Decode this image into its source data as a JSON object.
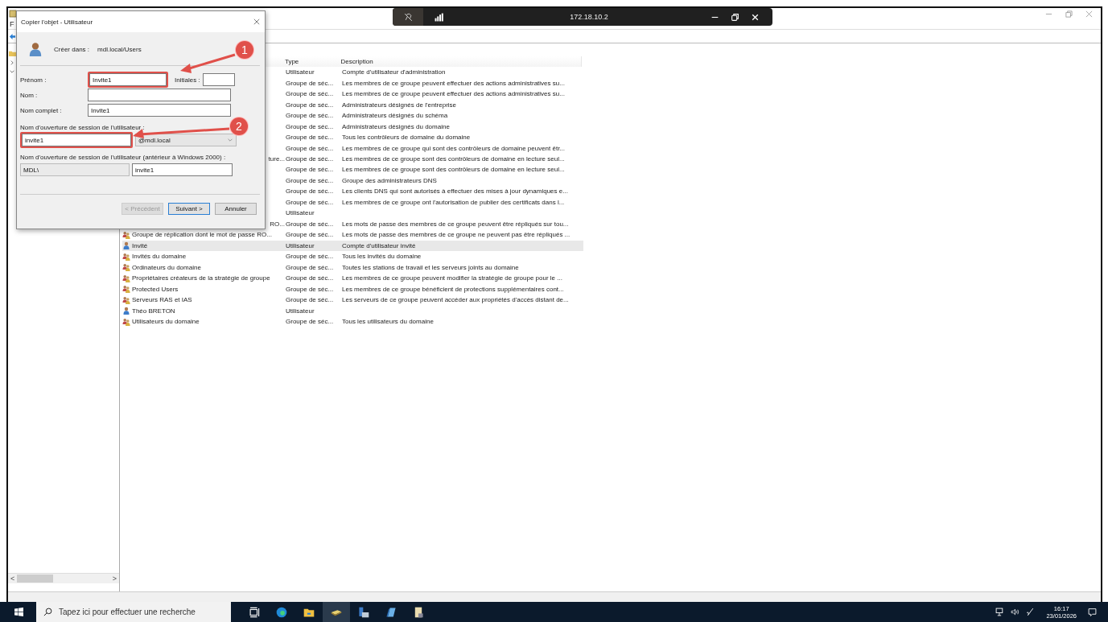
{
  "remote_bar": {
    "address": "172.18.10.2"
  },
  "main_window": {
    "menu": [
      "F"
    ]
  },
  "tree": {
    "items": [
      {
        "expanded": false
      },
      {
        "expanded": true
      }
    ]
  },
  "list": {
    "columns": [
      {
        "label": "Type"
      },
      {
        "label": "Description"
      }
    ],
    "rows": [
      {
        "type": "Utilisateur",
        "description": "Compte d'utilisateur d'administration",
        "selected": false
      },
      {
        "type": "Groupe de séc...",
        "description": "Les membres de ce groupe peuvent effectuer des actions administratives su...",
        "selected": false
      },
      {
        "type": "Groupe de séc...",
        "description": "Les membres de ce groupe peuvent effectuer des actions administratives su...",
        "selected": false
      },
      {
        "type": "Groupe de séc...",
        "description": "Administrateurs désignés de l'entreprise",
        "selected": false
      },
      {
        "type": "Groupe de séc...",
        "description": "Administrateurs désignés du schéma",
        "selected": false
      },
      {
        "type": "Groupe de séc...",
        "description": "Administrateurs désignés du domaine",
        "selected": false
      },
      {
        "type": "Groupe de séc...",
        "description": "Tous les contrôleurs de domaine du domaine",
        "selected": false
      },
      {
        "type": "Groupe de séc...",
        "description": "Les membres de ce groupe qui sont des contrôleurs de domaine peuvent êtr...",
        "selected": false
      },
      {
        "name": "ture...",
        "cut": true,
        "type": "Groupe de séc...",
        "description": "Les membres de ce groupe sont des contrôleurs de domaine en lecture seul...",
        "selected": false
      },
      {
        "type": "Groupe de séc...",
        "description": "Les membres de ce groupe sont des contrôleurs de domaine en lecture seul...",
        "selected": false
      },
      {
        "type": "Groupe de séc...",
        "description": "Groupe des administrateurs DNS",
        "selected": false
      },
      {
        "type": "Groupe de séc...",
        "description": "Les clients DNS qui sont autorisés à effectuer des mises à jour dynamiques e...",
        "selected": false
      },
      {
        "type": "Groupe de séc...",
        "description": "Les membres de ce groupe ont l'autorisation de publier des certificats dans l...",
        "selected": false
      },
      {
        "type": "Utilisateur",
        "selected": false
      },
      {
        "name": "RO...",
        "cut": true,
        "type": "Groupe de séc...",
        "description": "Les mots de passe des membres de ce groupe peuvent être répliqués sur tou...",
        "selected": false
      },
      {
        "name": "Groupe de réplication dont le mot de passe RO...",
        "kind": "group",
        "type": "Groupe de séc...",
        "description": "Les mots de passe des membres de ce groupe ne peuvent pas être répliqués ...",
        "selected": false
      },
      {
        "name": "Invité",
        "kind": "user",
        "type": "Utilisateur",
        "description": "Compte d'utilisateur invité",
        "selected": true
      },
      {
        "name": "Invités du domaine",
        "kind": "group",
        "type": "Groupe de séc...",
        "description": "Tous les invités du domaine",
        "selected": false
      },
      {
        "name": "Ordinateurs du domaine",
        "kind": "group",
        "type": "Groupe de séc...",
        "description": "Toutes les stations de travail et les serveurs joints au domaine",
        "selected": false
      },
      {
        "name": "Propriétaires créateurs de la stratégie de groupe",
        "kind": "group",
        "type": "Groupe de séc...",
        "description": "Les membres de ce groupe peuvent modifier la stratégie de groupe pour le ...",
        "selected": false
      },
      {
        "name": "Protected Users",
        "kind": "group",
        "type": "Groupe de séc...",
        "description": "Les membres de ce groupe bénéficient de protections supplémentaires cont...",
        "selected": false
      },
      {
        "name": "Serveurs RAS et IAS",
        "kind": "group",
        "type": "Groupe de séc...",
        "description": "Les serveurs de ce groupe peuvent accéder aux propriétés d'accès distant de...",
        "selected": false
      },
      {
        "name": "Théo BRETON",
        "kind": "user",
        "type": "Utilisateur",
        "selected": false
      },
      {
        "name": "Utilisateurs du domaine",
        "kind": "group",
        "type": "Groupe de séc...",
        "description": "Tous les utilisateurs du domaine",
        "selected": false
      }
    ]
  },
  "scrollbar": {
    "left": "<",
    "right": ">"
  },
  "dialog": {
    "title": "Copier l'objet - Utilisateur",
    "create_in_label": "Créer dans :",
    "create_in": "mdl.local/Users",
    "first_name": {
      "label": "Prénom :",
      "value": "Invite1",
      "highlighted": true
    },
    "initials": {
      "label": "Initiales :"
    },
    "last_name": {
      "label": "Nom :"
    },
    "full_name": {
      "label": "Nom complet :",
      "value": "Invite1"
    },
    "logon_label": "Nom d'ouverture de session de l'utilisateur :",
    "logon": {
      "value": "invite1",
      "highlighted": true
    },
    "domain": {
      "value": "@mdl.local"
    },
    "legacy_label": "Nom d'ouverture de session de l'utilisateur (antérieur à Windows 2000) :",
    "legacy_prefix": "MDL\\",
    "legacy_value": "invite1",
    "buttons": [
      {
        "label": "< Précédent",
        "disabled": true,
        "default": false
      },
      {
        "label": "Suivant >",
        "disabled": false,
        "default": true
      },
      {
        "label": "Annuler",
        "disabled": false,
        "default": false
      }
    ]
  },
  "annotations": [
    {
      "number": "1"
    },
    {
      "number": "2"
    }
  ],
  "taskbar": {
    "search_placeholder": "Tapez ici pour effectuer une recherche",
    "time": "16:17",
    "date": "23/01/2026"
  }
}
